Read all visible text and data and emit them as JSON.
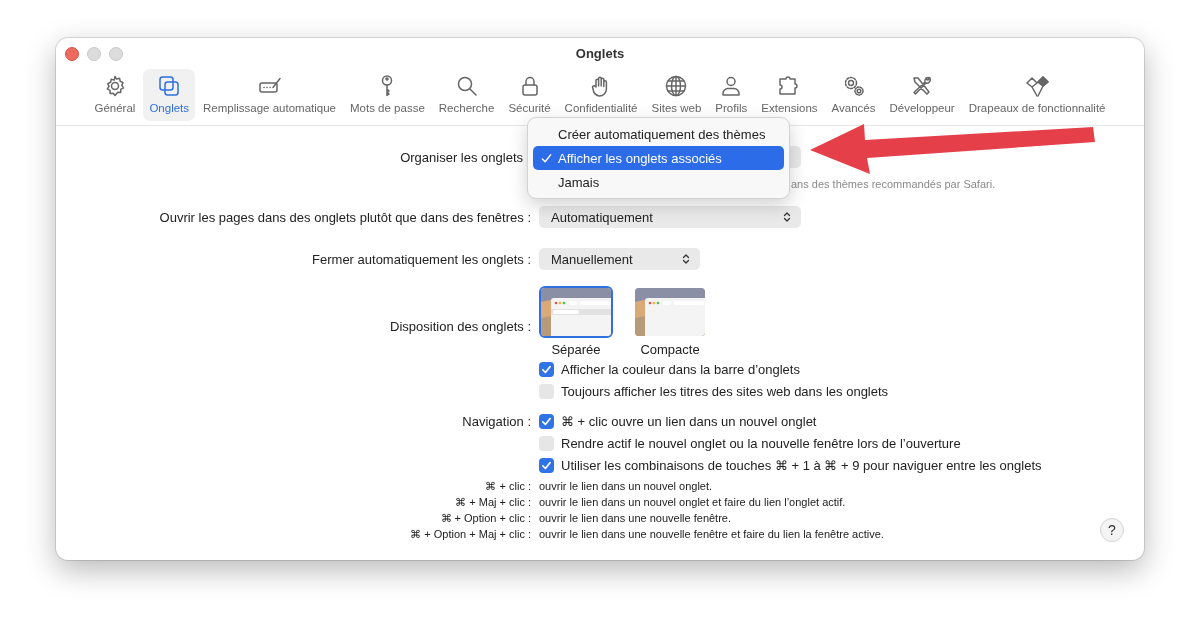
{
  "window": {
    "title": "Onglets"
  },
  "toolbar": [
    {
      "label": "Général",
      "selected": false
    },
    {
      "label": "Onglets",
      "selected": true
    },
    {
      "label": "Remplissage automatique",
      "selected": false
    },
    {
      "label": "Mots de passe",
      "selected": false
    },
    {
      "label": "Recherche",
      "selected": false
    },
    {
      "label": "Sécurité",
      "selected": false
    },
    {
      "label": "Confidentialité",
      "selected": false
    },
    {
      "label": "Sites web",
      "selected": false
    },
    {
      "label": "Profils",
      "selected": false
    },
    {
      "label": "Extensions",
      "selected": false
    },
    {
      "label": "Avancés",
      "selected": false
    },
    {
      "label": "Développeur",
      "selected": false
    },
    {
      "label": "Drapeaux de fonctionnalité",
      "selected": false
    }
  ],
  "organize": {
    "label": "Organiser les onglets",
    "hint": "ans des thèmes recommandés par Safari.",
    "menu": [
      {
        "label": "Créer automatiquement des thèmes",
        "selected": false
      },
      {
        "label": "Afficher les onglets associés",
        "selected": true
      },
      {
        "label": "Jamais",
        "selected": false
      }
    ]
  },
  "open_pages": {
    "label": "Ouvrir les pages dans des onglets plutôt que dans des fenêtres :",
    "value": "Automatiquement"
  },
  "close_tabs": {
    "label": "Fermer automatiquement les onglets :",
    "value": "Manuellement"
  },
  "layout": {
    "label": "Disposition des onglets :",
    "options": [
      {
        "caption": "Séparée",
        "selected": true
      },
      {
        "caption": "Compacte",
        "selected": false
      }
    ],
    "checkboxes": [
      {
        "label": "Afficher la couleur dans la barre d’onglets",
        "checked": true
      },
      {
        "label": "Toujours afficher les titres des sites web dans les onglets",
        "checked": false
      }
    ]
  },
  "navigation": {
    "label": "Navigation :",
    "checkboxes": [
      {
        "label": "⌘ + clic ouvre un lien dans un nouvel onglet",
        "checked": true
      },
      {
        "label": "Rendre actif le nouvel onglet ou la nouvelle fenêtre lors de l’ouverture",
        "checked": false
      },
      {
        "label": "Utiliser les combinaisons de touches ⌘ + 1 à ⌘ + 9 pour naviguer entre les onglets",
        "checked": true
      }
    ]
  },
  "shortcuts": [
    {
      "keys": "⌘ + clic :",
      "description": "ouvrir le lien dans un nouvel onglet."
    },
    {
      "keys": "⌘ + Maj + clic :",
      "description": "ouvrir le lien dans un nouvel onglet et faire du lien l’onglet actif."
    },
    {
      "keys": "⌘ + Option + clic :",
      "description": "ouvrir le lien dans une nouvelle fenêtre."
    },
    {
      "keys": "⌘ + Option + Maj + clic :",
      "description": "ouvrir le lien dans une nouvelle fenêtre et faire du lien la fenêtre active."
    }
  ],
  "help_button": "?"
}
